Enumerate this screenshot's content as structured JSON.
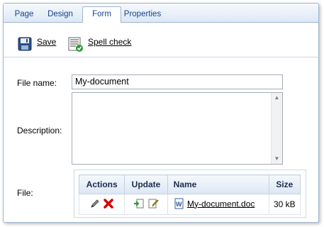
{
  "tabs": [
    {
      "label": "Page",
      "active": false
    },
    {
      "label": "Design",
      "active": false
    },
    {
      "label": "Form",
      "active": true
    },
    {
      "label": "Properties",
      "active": false
    }
  ],
  "toolbar": {
    "save_label": "Save",
    "spellcheck_label": "Spell check"
  },
  "form": {
    "filename_label": "File name:",
    "filename_value": "My-document",
    "description_label": "Description:",
    "description_value": "",
    "file_label": "File:"
  },
  "file_table": {
    "headers": {
      "actions": "Actions",
      "update": "Update",
      "name": "Name",
      "size": "Size"
    },
    "row": {
      "name": "My-document.doc",
      "size": "30 kB"
    }
  },
  "colors": {
    "tab_text": "#15428b",
    "border": "#9eb6ce",
    "delete_red": "#d40000"
  }
}
